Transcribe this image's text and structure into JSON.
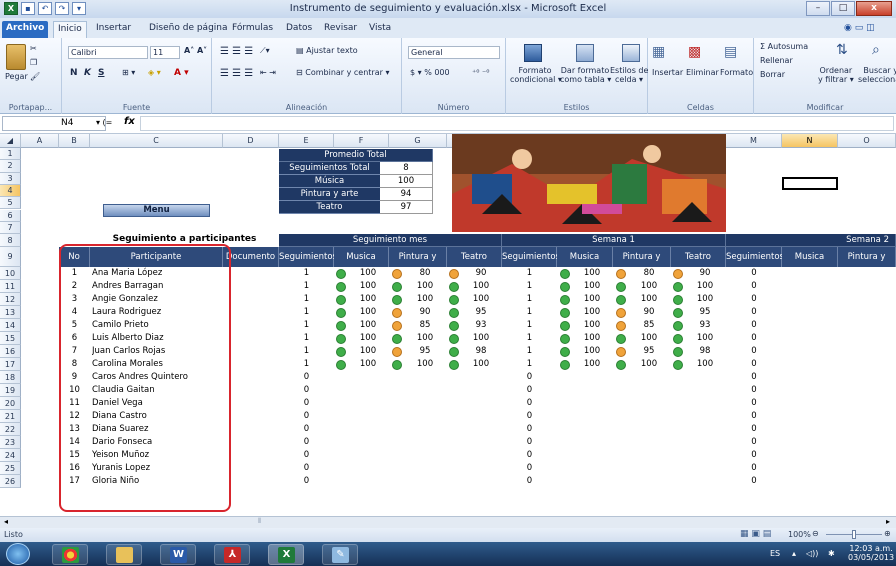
{
  "window": {
    "title": "Instrumento de seguimiento y evaluación.xlsx - Microsoft Excel",
    "min": "–",
    "max": "□",
    "close": "x"
  },
  "tabs": [
    "Archivo",
    "Inicio",
    "Insertar",
    "Diseño de página",
    "Fórmulas",
    "Datos",
    "Revisar",
    "Vista"
  ],
  "ribbon": {
    "paste": "Pegar",
    "clipboard": "Portapap...",
    "font_name": "Calibri",
    "font_size": "11",
    "font_group": "Fuente",
    "bold": "N",
    "italic": "K",
    "underline": "S",
    "align_group": "Alineación",
    "wrap": "Ajustar texto",
    "merge": "Combinar y centrar",
    "number_format": "General",
    "number_group": "Número",
    "currency": "$ ▾ % 000",
    "cond_format1": "Formato",
    "cond_format2": "condicional",
    "table_format1": "Dar formato",
    "table_format2": "como tabla",
    "cell_styles1": "Estilos de",
    "cell_styles2": "celda",
    "styles_group": "Estilos",
    "insert": "Insertar",
    "delete": "Eliminar",
    "format": "Formato",
    "cells_group": "Celdas",
    "autosum": "Σ Autosuma",
    "fill": "Rellenar",
    "clear": "Borrar",
    "sort1": "Ordenar",
    "sort2": "y filtrar",
    "find1": "Buscar y",
    "find2": "seleccionar",
    "modify_group": "Modificar"
  },
  "formula_bar": {
    "cell": "N4",
    "fx": "fx"
  },
  "columns": [
    "A",
    "B",
    "C",
    "D",
    "E",
    "F",
    "G",
    "H",
    "I",
    "J",
    "K",
    "L",
    "M",
    "N",
    "O"
  ],
  "rows": [
    "1",
    "2",
    "3",
    "4",
    "5",
    "6",
    "7",
    "8",
    "9",
    "10",
    "11",
    "12",
    "13",
    "14",
    "15",
    "16",
    "17",
    "18",
    "19",
    "20",
    "21",
    "22",
    "23",
    "24",
    "25",
    "26"
  ],
  "summary": {
    "title": "Promedio Total",
    "rows": [
      {
        "label": "Seguimientos Total",
        "value": "8"
      },
      {
        "label": "Música",
        "value": "100"
      },
      {
        "label": "Pintura y arte",
        "value": "94"
      },
      {
        "label": "Teatro",
        "value": "97"
      }
    ]
  },
  "menu_button": "Menu",
  "section_title": "Seguimiento a participantes",
  "group_headers": {
    "mes": "Seguimiento mes",
    "semana1": "Semana 1",
    "semana2": "Semana 2"
  },
  "headers": {
    "no": "No",
    "participante": "Participante",
    "documento": "Documento",
    "seguimientos": "Seguimientos",
    "musica": "Musica",
    "pintura": "Pintura y arte",
    "teatro": "Teatro"
  },
  "participants": [
    {
      "no": "1",
      "name": "Ana Maria López",
      "seg": "1",
      "mus": "100",
      "pin": "80",
      "tea": "90",
      "s1": "1",
      "s1m": "100",
      "s1p": "80",
      "s1t": "90",
      "s2": "0",
      "icons": [
        "g",
        "o",
        "o"
      ]
    },
    {
      "no": "2",
      "name": "Andres Barragan",
      "seg": "1",
      "mus": "100",
      "pin": "100",
      "tea": "100",
      "s1": "1",
      "s1m": "100",
      "s1p": "100",
      "s1t": "100",
      "s2": "0",
      "icons": [
        "g",
        "g",
        "g"
      ]
    },
    {
      "no": "3",
      "name": "Angie Gonzalez",
      "seg": "1",
      "mus": "100",
      "pin": "100",
      "tea": "100",
      "s1": "1",
      "s1m": "100",
      "s1p": "100",
      "s1t": "100",
      "s2": "0",
      "icons": [
        "g",
        "g",
        "g"
      ]
    },
    {
      "no": "4",
      "name": "Laura Rodriguez",
      "seg": "1",
      "mus": "100",
      "pin": "90",
      "tea": "95",
      "s1": "1",
      "s1m": "100",
      "s1p": "90",
      "s1t": "95",
      "s2": "0",
      "icons": [
        "g",
        "o",
        "g"
      ]
    },
    {
      "no": "5",
      "name": "Camilo Prieto",
      "seg": "1",
      "mus": "100",
      "pin": "85",
      "tea": "93",
      "s1": "1",
      "s1m": "100",
      "s1p": "85",
      "s1t": "93",
      "s2": "0",
      "icons": [
        "g",
        "o",
        "g"
      ]
    },
    {
      "no": "6",
      "name": "Luis Alberto Diaz",
      "seg": "1",
      "mus": "100",
      "pin": "100",
      "tea": "100",
      "s1": "1",
      "s1m": "100",
      "s1p": "100",
      "s1t": "100",
      "s2": "0",
      "icons": [
        "g",
        "g",
        "g"
      ]
    },
    {
      "no": "7",
      "name": "Juan Carlos Rojas",
      "seg": "1",
      "mus": "100",
      "pin": "95",
      "tea": "98",
      "s1": "1",
      "s1m": "100",
      "s1p": "95",
      "s1t": "98",
      "s2": "0",
      "icons": [
        "g",
        "o",
        "g"
      ]
    },
    {
      "no": "8",
      "name": "Carolina Morales",
      "seg": "1",
      "mus": "100",
      "pin": "100",
      "tea": "100",
      "s1": "1",
      "s1m": "100",
      "s1p": "100",
      "s1t": "100",
      "s2": "0",
      "icons": [
        "g",
        "g",
        "g"
      ]
    },
    {
      "no": "9",
      "name": "Caros Andres Quintero",
      "seg": "0",
      "s1": "0",
      "s2": "0"
    },
    {
      "no": "10",
      "name": "Claudia Gaitan",
      "seg": "0",
      "s1": "0",
      "s2": "0"
    },
    {
      "no": "11",
      "name": "Daniel Vega",
      "seg": "0",
      "s1": "0",
      "s2": "0"
    },
    {
      "no": "12",
      "name": "Diana Castro",
      "seg": "0",
      "s1": "0",
      "s2": "0"
    },
    {
      "no": "13",
      "name": "Diana Suarez",
      "seg": "0",
      "s1": "0",
      "s2": "0"
    },
    {
      "no": "14",
      "name": "Dario Fonseca",
      "seg": "0",
      "s1": "0",
      "s2": "0"
    },
    {
      "no": "15",
      "name": "Yeison Muñoz",
      "seg": "0",
      "s1": "0",
      "s2": "0"
    },
    {
      "no": "16",
      "name": "Yuranis Lopez",
      "seg": "0",
      "s1": "0",
      "s2": "0"
    },
    {
      "no": "17",
      "name": "Gloria Niño",
      "seg": "0",
      "s1": "0",
      "s2": "0"
    }
  ],
  "status": {
    "ready": "Listo",
    "zoom": "100%"
  },
  "taskbar": {
    "lang": "ES",
    "time": "12:03 a.m.",
    "date": "03/05/2013"
  },
  "colors": {
    "header_blue": "#1f3864",
    "green_icon": "#3fae49",
    "orange_icon": "#f0a33a",
    "highlight_red": "#d8252d"
  }
}
